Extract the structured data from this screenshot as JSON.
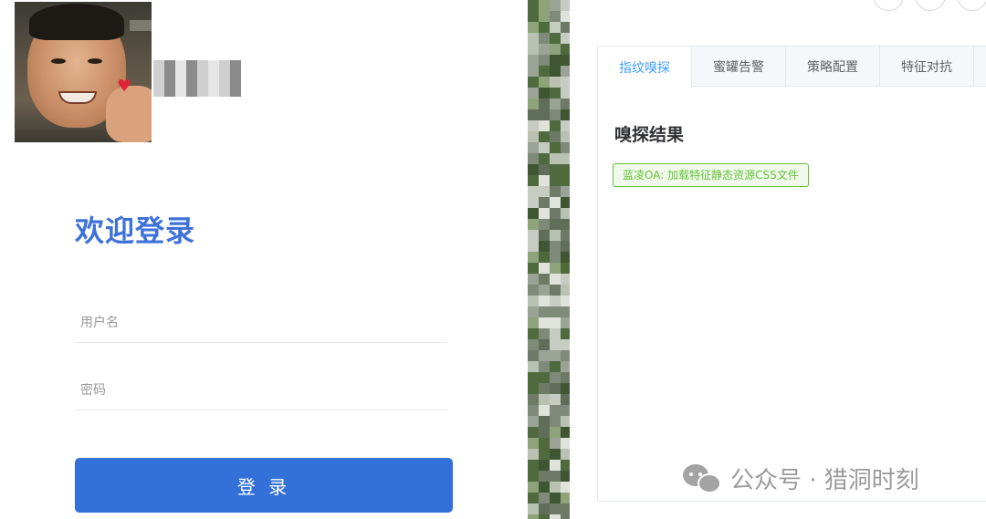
{
  "login": {
    "blurred_username_text": "",
    "welcome_title": "欢迎登录",
    "username_placeholder": "用户名",
    "password_placeholder": "密码",
    "username_value": "",
    "password_value": "",
    "login_button_label": "登 录"
  },
  "panel": {
    "tabs": [
      {
        "label": "指纹嗅探",
        "active": true
      },
      {
        "label": "蜜罐告警",
        "active": false
      },
      {
        "label": "策略配置",
        "active": false
      },
      {
        "label": "特征对抗",
        "active": false
      }
    ],
    "section_title": "嗅探结果",
    "result_tag": "蓝凌OA: 加载特征静态资源CSS文件"
  },
  "watermark": {
    "text": "公众号 · 猎洞时刻",
    "icon": "wechat-icon"
  },
  "colors": {
    "primary_blue": "#3371d9",
    "welcome_blue": "#3f72d8",
    "tab_active": "#409eff",
    "tag_green": "#67c23a",
    "tag_bg": "#f0f9eb"
  }
}
